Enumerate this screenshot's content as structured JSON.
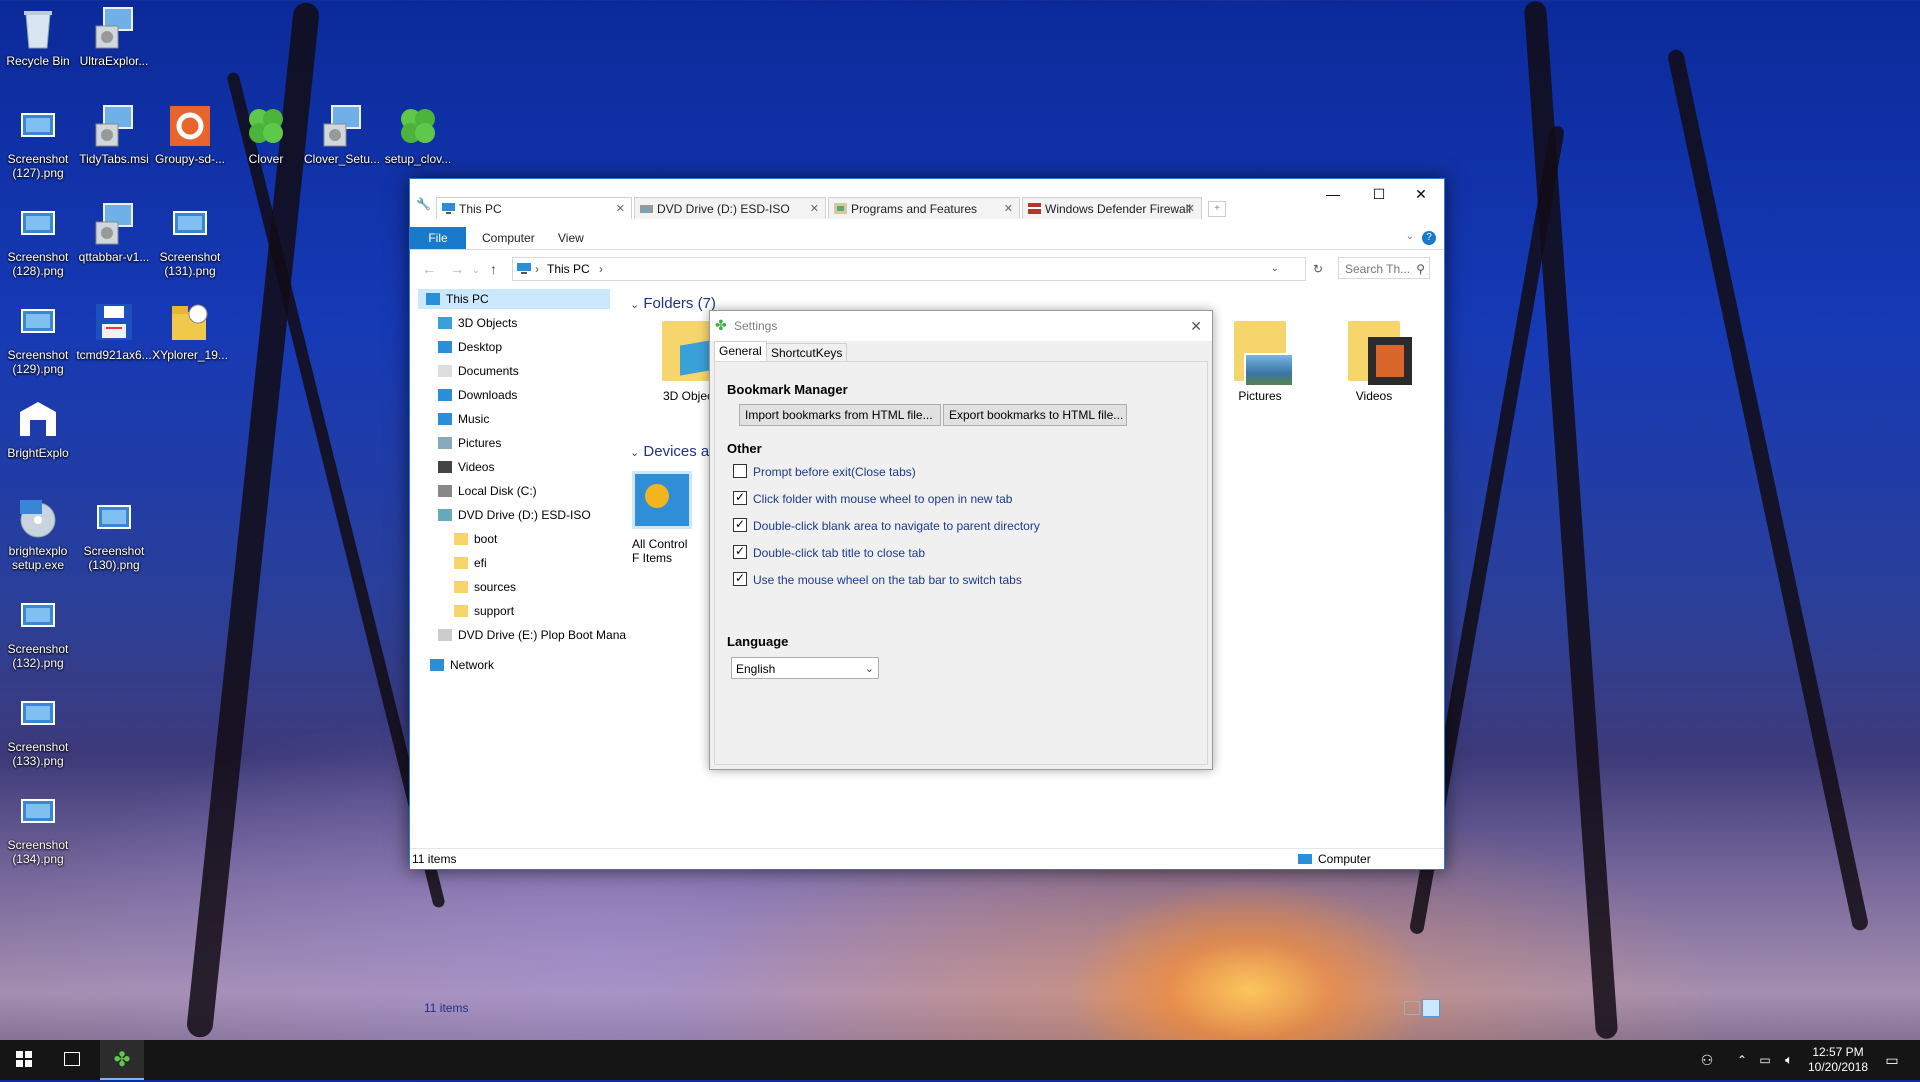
{
  "desktop": {
    "icons": [
      {
        "label": "Recycle Bin",
        "icon": "recycle-bin-icon"
      },
      {
        "label": "UltraExplor...",
        "icon": "installer-icon"
      },
      {
        "label": "Screenshot (127).png",
        "icon": "image-file-icon"
      },
      {
        "label": "TidyTabs.msi",
        "icon": "installer-icon"
      },
      {
        "label": "Groupy-sd-...",
        "icon": "groupy-icon"
      },
      {
        "label": "Clover",
        "icon": "clover-icon"
      },
      {
        "label": "Clover_Setu...",
        "icon": "installer-icon"
      },
      {
        "label": "setup_clov...",
        "icon": "clover-icon"
      },
      {
        "label": "Screenshot (128).png",
        "icon": "image-file-icon"
      },
      {
        "label": "qttabbar-v1...",
        "icon": "installer-icon"
      },
      {
        "label": "Screenshot (131).png",
        "icon": "image-file-icon"
      },
      {
        "label": "Screenshot (129).png",
        "icon": "image-file-icon"
      },
      {
        "label": "tcmd921ax6...",
        "icon": "floppy-icon"
      },
      {
        "label": "XYplorer_19...",
        "icon": "xyplorer-icon"
      },
      {
        "label": "BrightExplo",
        "icon": "brightexplorer-icon"
      },
      {
        "label": "brightexplo setup.exe",
        "icon": "cd-setup-icon"
      },
      {
        "label": "Screenshot (130).png",
        "icon": "image-file-icon"
      },
      {
        "label": "Screenshot (132).png",
        "icon": "image-file-icon"
      },
      {
        "label": "Screenshot (133).png",
        "icon": "image-file-icon"
      },
      {
        "label": "Screenshot (134).png",
        "icon": "image-file-icon"
      }
    ]
  },
  "explorer": {
    "tabs": [
      {
        "label": "This PC"
      },
      {
        "label": "DVD Drive (D:) ESD-ISO"
      },
      {
        "label": "Programs and Features"
      },
      {
        "label": "Windows Defender Firewall"
      }
    ],
    "ribbon": {
      "file": "File",
      "computer": "Computer",
      "view": "View"
    },
    "address": {
      "path": "This PC"
    },
    "search": {
      "placeholder": "Search Th..."
    },
    "nav": [
      {
        "label": "This PC"
      },
      {
        "label": "3D Objects"
      },
      {
        "label": "Desktop"
      },
      {
        "label": "Documents"
      },
      {
        "label": "Downloads"
      },
      {
        "label": "Music"
      },
      {
        "label": "Pictures"
      },
      {
        "label": "Videos"
      },
      {
        "label": "Local Disk (C:)"
      },
      {
        "label": "DVD Drive (D:) ESD-ISO"
      },
      {
        "label": "boot"
      },
      {
        "label": "efi"
      },
      {
        "label": "sources"
      },
      {
        "label": "support"
      },
      {
        "label": "DVD Drive (E:) Plop Boot Mana"
      },
      {
        "label": "Network"
      }
    ],
    "groups": {
      "folders": "Folders (7)",
      "devices": "Devices a"
    },
    "folders": [
      {
        "label": "3D Objec"
      },
      {
        "label": "Pictures"
      },
      {
        "label": "Videos"
      }
    ],
    "devices": [
      {
        "label": "All Control F Items"
      }
    ],
    "item_count": "11 items",
    "status_left": "11 items",
    "status_right": "Computer"
  },
  "settings": {
    "title": "Settings",
    "tabs": {
      "general": "General",
      "shortcut": "ShortcutKeys"
    },
    "bookmark_header": "Bookmark Manager",
    "import_btn": "Import bookmarks from HTML file...",
    "export_btn": "Export bookmarks to HTML file...",
    "other_header": "Other",
    "options": [
      {
        "label": "Prompt before exit(Close tabs)",
        "checked": false
      },
      {
        "label": "Click folder with mouse wheel to open in new tab",
        "checked": true
      },
      {
        "label": "Double-click blank area to navigate to parent directory",
        "checked": true
      },
      {
        "label": "Double-click tab title to close tab",
        "checked": true
      },
      {
        "label": "Use the mouse wheel on the tab bar to switch tabs",
        "checked": true
      }
    ],
    "language_header": "Language",
    "language_value": "English"
  },
  "taskbar": {
    "time": "12:57 PM",
    "date": "10/20/2018"
  }
}
